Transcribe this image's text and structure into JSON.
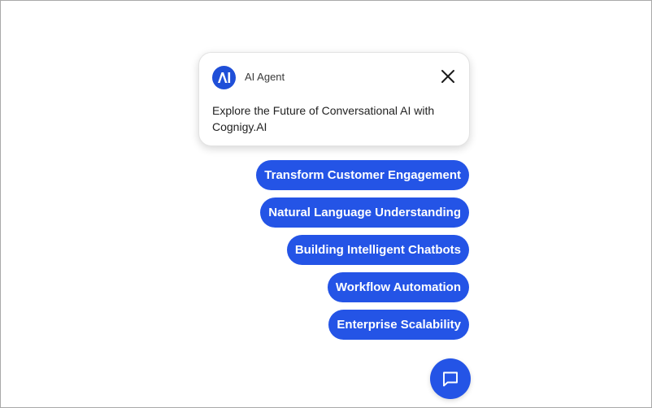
{
  "popup": {
    "agent_name": "AI Agent",
    "avatar_icon": "cognigy-logo-icon",
    "close_icon": "close-icon",
    "message": "Explore the Future of Conversational AI with Cognigy.AI"
  },
  "quick_replies": [
    {
      "label": "Transform Customer Engagement"
    },
    {
      "label": "Natural Language Understanding"
    },
    {
      "label": "Building Intelligent Chatbots"
    },
    {
      "label": "Workflow Automation"
    },
    {
      "label": "Enterprise Scalability"
    }
  ],
  "launcher": {
    "icon": "chat-icon"
  },
  "colors": {
    "accent": "#2454e6",
    "avatar": "#1f4fd8"
  }
}
